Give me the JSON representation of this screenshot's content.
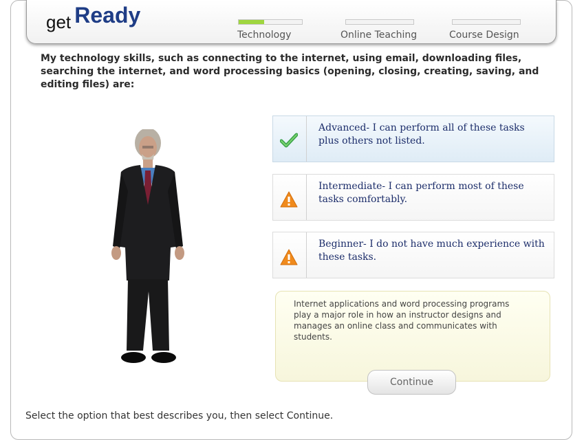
{
  "logo": {
    "prefix": "get",
    "name": "Ready"
  },
  "progress": [
    {
      "label": "Technology",
      "fill": 0.4
    },
    {
      "label": "Online Teaching",
      "fill": 0
    },
    {
      "label": "Course Design",
      "fill": 0
    }
  ],
  "question": "My technology skills, such as connecting to the internet, using email, downloading files, searching the internet, and word processing basics (opening, closing, creating, saving, and editing files) are:",
  "options": [
    {
      "text": "Advanced- I can perform all of these tasks plus others not listed.",
      "icon": "checkmark-icon",
      "selected": true
    },
    {
      "text": "Intermediate- I can perform most of these tasks comfortably.",
      "icon": "warning-icon",
      "selected": false
    },
    {
      "text": "Beginner- I do not have much experience with these tasks.",
      "icon": "warning-icon",
      "selected": false
    }
  ],
  "info": "Internet applications and word processing programs play a major role in how an instructor designs and manages an online class and communicates with students.",
  "continue_label": "Continue",
  "instruction": "Select the option that best describes you, then select Continue.",
  "colors": {
    "brand": "#1f3d86",
    "progress": "#9fd63f",
    "check": "#3aa34a",
    "warning": "#f08a1c"
  }
}
